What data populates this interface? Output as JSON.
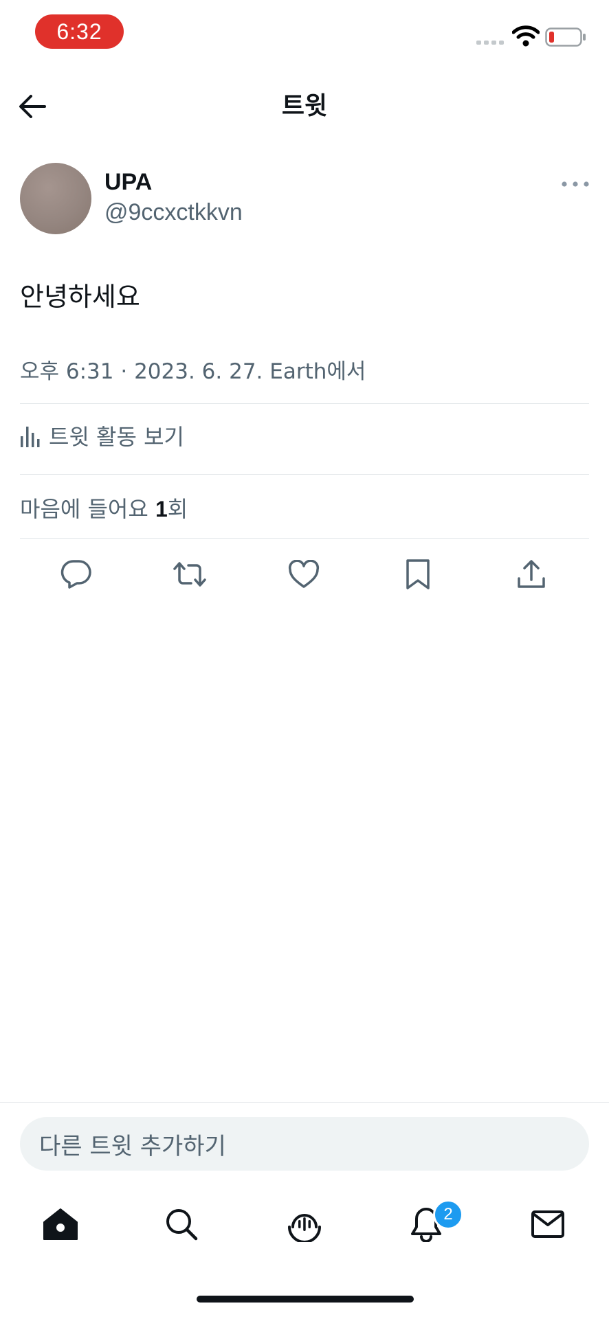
{
  "status_bar": {
    "time": "6:32",
    "icons": [
      "cellular-signal-icon",
      "wifi-icon",
      "battery-low-icon"
    ],
    "time_pill_color": "#e0312b",
    "battery_level_fraction": 0.15
  },
  "header": {
    "title": "트윗",
    "back_icon": "arrow-left-icon"
  },
  "tweet": {
    "author_name": "UPA",
    "author_handle": "@9ccxctkkvn",
    "text": "안녕하세요",
    "meta": "오후 6:31 · 2023. 6. 27. Earth에서",
    "activity_label": "트윗 활동 보기",
    "likes_prefix": "마음에 들어요 ",
    "likes_count": "1",
    "likes_suffix": "회",
    "more_icon": "more-dots-icon"
  },
  "actions": [
    "reply-icon",
    "retweet-icon",
    "like-icon",
    "bookmark-icon",
    "share-icon"
  ],
  "compose": {
    "placeholder": "다른 트윗 추가하기"
  },
  "tab_bar": {
    "items": [
      "home-icon",
      "search-icon",
      "spaces-icon",
      "notifications-icon",
      "messages-icon"
    ],
    "notification_badge": "2",
    "badge_color": "#1d9bf0"
  }
}
